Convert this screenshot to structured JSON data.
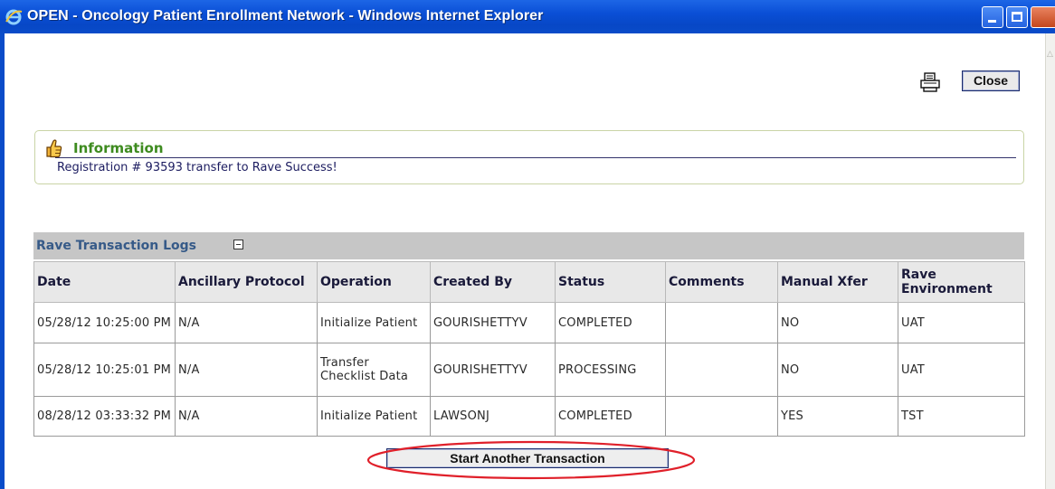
{
  "window": {
    "title": "OPEN - Oncology Patient Enrollment Network - Windows Internet Explorer"
  },
  "toolbar": {
    "print_icon": "printer-icon",
    "close_label": "Close"
  },
  "info": {
    "icon": "thumbs-up-icon",
    "title": "Information",
    "message": "Registration # 93593 transfer to Rave Success!"
  },
  "logs": {
    "title": "Rave Transaction Logs",
    "collapse_icon": "collapse-minus-icon",
    "columns": [
      "Date",
      "Ancillary Protocol",
      "Operation",
      "Created By",
      "Status",
      "Comments",
      "Manual Xfer",
      "Rave Environment"
    ],
    "rows": [
      {
        "date": "05/28/12 10:25:00 PM",
        "ancillary": "N/A",
        "operation": "Initialize Patient",
        "created_by": "GOURISHETTYV",
        "status": "COMPLETED",
        "comments": "",
        "manual": "NO",
        "env": "UAT"
      },
      {
        "date": "05/28/12 10:25:01 PM",
        "ancillary": "N/A",
        "operation": "Transfer Checklist Data",
        "created_by": "GOURISHETTYV",
        "status": "PROCESSING",
        "comments": "",
        "manual": "NO",
        "env": "UAT"
      },
      {
        "date": "08/28/12 03:33:32 PM",
        "ancillary": "N/A",
        "operation": "Initialize Patient",
        "created_by": "LAWSONJ",
        "status": "COMPLETED",
        "comments": "",
        "manual": "YES",
        "env": "TST"
      }
    ]
  },
  "actions": {
    "start_another_label": "Start Another Transaction",
    "highlight_color": "#e0202a"
  }
}
